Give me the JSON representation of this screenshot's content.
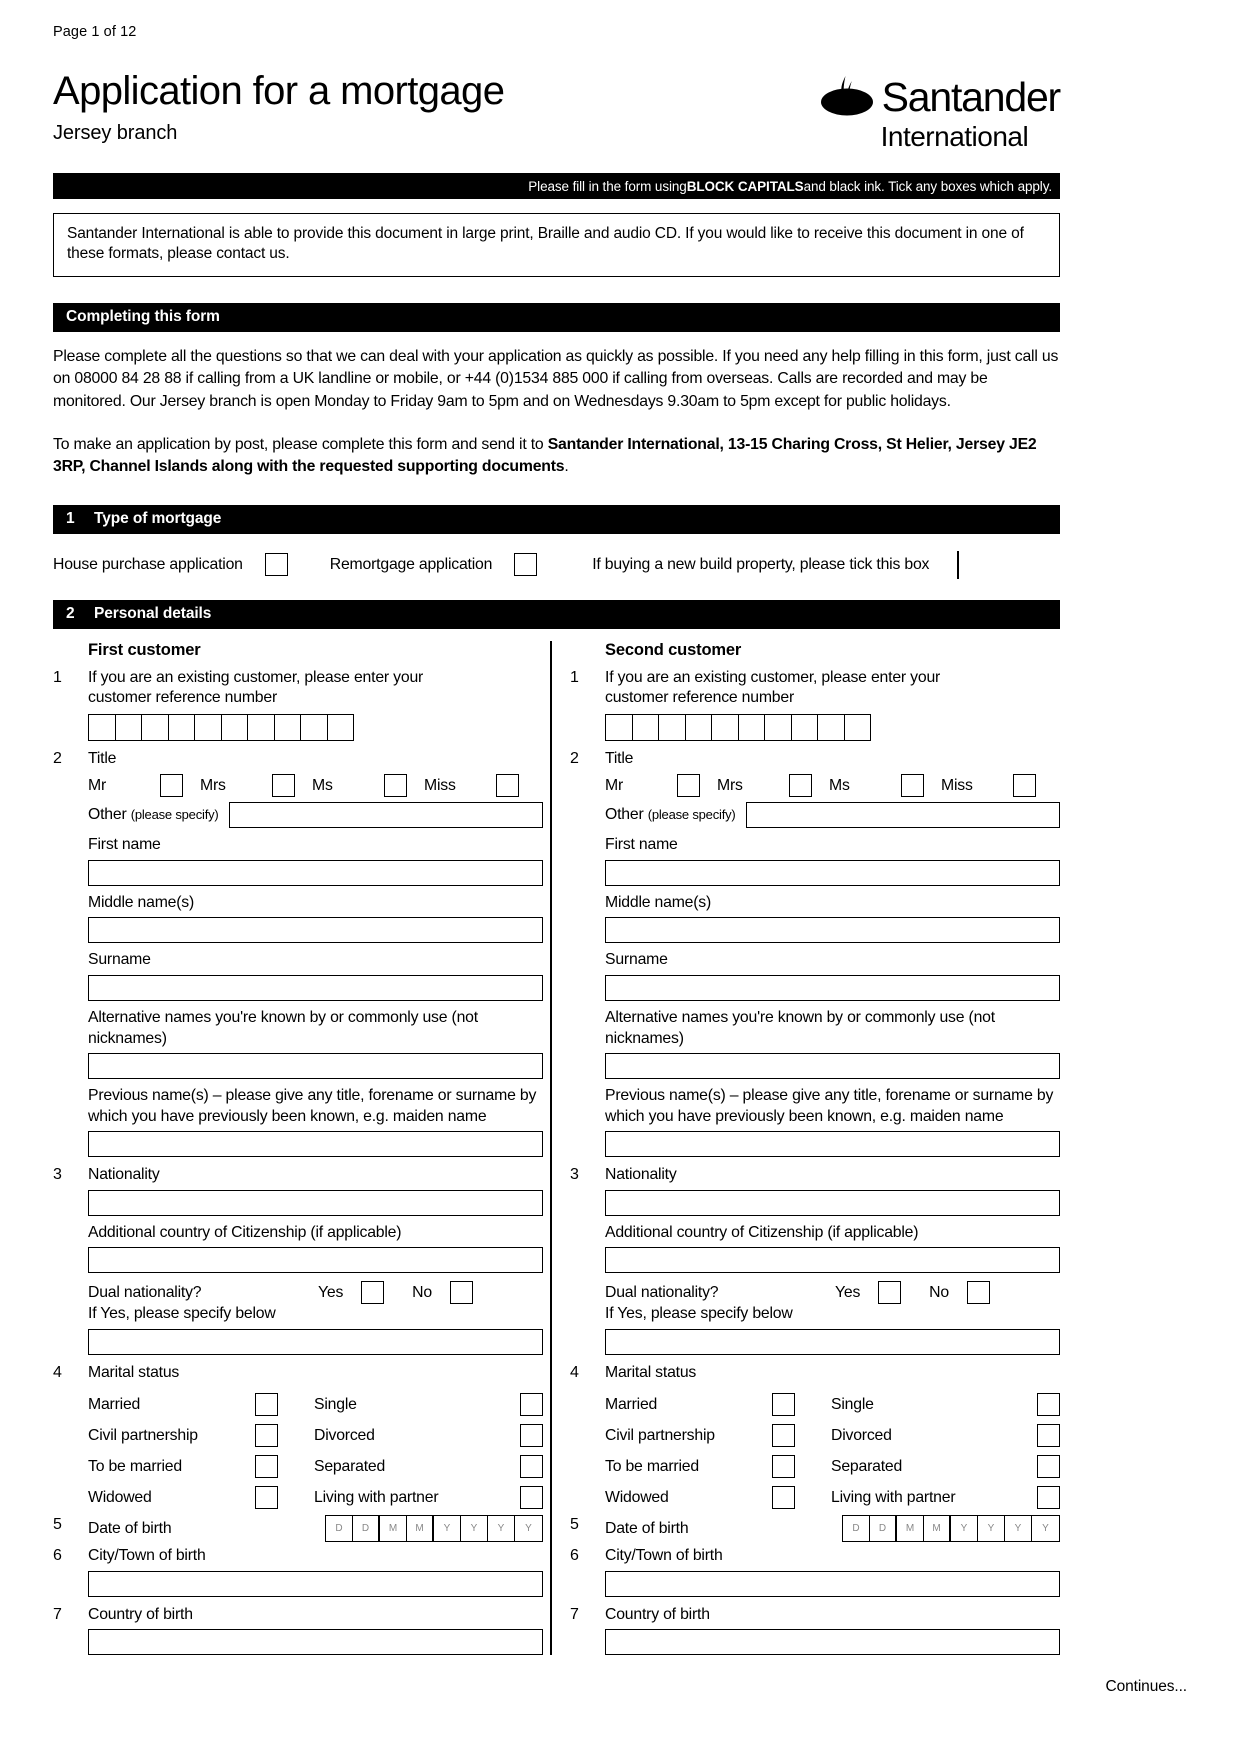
{
  "header": {
    "page_number": "Page 1 of 12",
    "title": "Application for a mortgage",
    "subtitle": "Jersey branch",
    "logo_word": "Santander",
    "logo_sub": "International",
    "logo_icon": "santander-flame-icon"
  },
  "instruction_bar": {
    "text_before": "Please fill in the form using ",
    "bold": "BLOCK CAPITALS",
    "text_after": " and black ink. Tick any boxes which apply."
  },
  "notice": {
    "text": "Santander International is able to provide this document in large print, Braille and audio CD. If you would like to receive this document in one of these formats, please contact us."
  },
  "completing": {
    "heading": "Completing this form",
    "para1": "Please complete all the questions so that we can deal with your application as quickly as possible. If you need any help filling in this form, just call us on 08000 84 28 88 if calling from a UK landline or mobile, or +44 (0)1534 885 000 if calling from overseas. Calls are recorded and may be monitored. Our Jersey branch is open Monday to Friday 9am to 5pm and on Wednesdays 9.30am to 5pm except for public holidays.",
    "para2_lead": "To make an application by post, please complete this form and send it to ",
    "para2_bold": "Santander International, 13-15 Charing Cross, St Helier, Jersey JE2 3RP, Channel Islands along with the requested supporting documents",
    "para2_tail": "."
  },
  "section1": {
    "number": "1",
    "heading": "Type of mortgage",
    "option_house": "House purchase application",
    "option_remortgage": "Remortgage application",
    "option_newbuild": "If buying a new build property, please tick this box"
  },
  "section2": {
    "number": "2",
    "heading": "Personal details"
  },
  "customers": [
    {
      "heading": "First customer",
      "q1_num": "1",
      "q1_label_line1": "If you are an existing customer, please enter your",
      "q1_label_line2": "customer reference number",
      "q1_cells": 10,
      "q2_num": "2",
      "q2_label": "Title",
      "titles": [
        "Mr",
        "Mrs",
        "Ms",
        "Miss"
      ],
      "other_label": "Other ",
      "other_label_small": "(please specify)",
      "first_name_label": "First name",
      "middle_name_label": "Middle name(s)",
      "surname_label": "Surname",
      "alt_names_label": "Alternative names you're known by or commonly use (not nicknames)",
      "prev_names_line1": "Previous name(s) – please give any title, forename or surname by",
      "prev_names_line2": "which you have previously been known, e.g. maiden name",
      "q3_num": "3",
      "q3_label": "Nationality",
      "citizenship_label": "Additional country of Citizenship (if applicable)",
      "dual_label": "Dual nationality?",
      "dual_yes": "Yes",
      "dual_no": "No",
      "dual_specify": "If Yes, please specify below",
      "q4_num": "4",
      "q4_label": "Marital status",
      "marital": [
        [
          "Married",
          "Single"
        ],
        [
          "Civil partnership",
          "Divorced"
        ],
        [
          "To be married",
          "Separated"
        ],
        [
          "Widowed",
          "Living with partner"
        ]
      ],
      "q5_num": "5",
      "q5_label": "Date of birth",
      "dob_hints": [
        "D",
        "D",
        "M",
        "M",
        "Y",
        "Y",
        "Y",
        "Y"
      ],
      "q6_num": "6",
      "q6_label": "City/Town of birth",
      "q7_num": "7",
      "q7_label": "Country of birth"
    },
    {
      "heading": "Second customer",
      "q1_num": "1",
      "q1_label_line1": "If you are an existing customer, please enter your",
      "q1_label_line2": "customer reference number",
      "q1_cells": 10,
      "q2_num": "2",
      "q2_label": "Title",
      "titles": [
        "Mr",
        "Mrs",
        "Ms",
        "Miss"
      ],
      "other_label": "Other ",
      "other_label_small": "(please specify)",
      "first_name_label": "First name",
      "middle_name_label": "Middle name(s)",
      "surname_label": "Surname",
      "alt_names_label": "Alternative names you're known by or commonly use (not nicknames)",
      "prev_names_line1": "Previous name(s) – please give any title, forename or surname by",
      "prev_names_line2": "which you have previously been known, e.g. maiden name",
      "q3_num": "3",
      "q3_label": "Nationality",
      "citizenship_label": "Additional country of Citizenship (if applicable)",
      "dual_label": "Dual nationality?",
      "dual_yes": "Yes",
      "dual_no": "No",
      "dual_specify": "If Yes, please specify below",
      "q4_num": "4",
      "q4_label": "Marital status",
      "marital": [
        [
          "Married",
          "Single"
        ],
        [
          "Civil partnership",
          "Divorced"
        ],
        [
          "To be married",
          "Separated"
        ],
        [
          "Widowed",
          "Living with partner"
        ]
      ],
      "q5_num": "5",
      "q5_label": "Date of birth",
      "dob_hints": [
        "D",
        "D",
        "M",
        "M",
        "Y",
        "Y",
        "Y",
        "Y"
      ],
      "q6_num": "6",
      "q6_label": "City/Town of birth",
      "q7_num": "7",
      "q7_label": "Country of birth"
    }
  ],
  "footer": {
    "continues": "Continues..."
  },
  "colors": {
    "ink": "#000000",
    "paper": "#ffffff"
  }
}
